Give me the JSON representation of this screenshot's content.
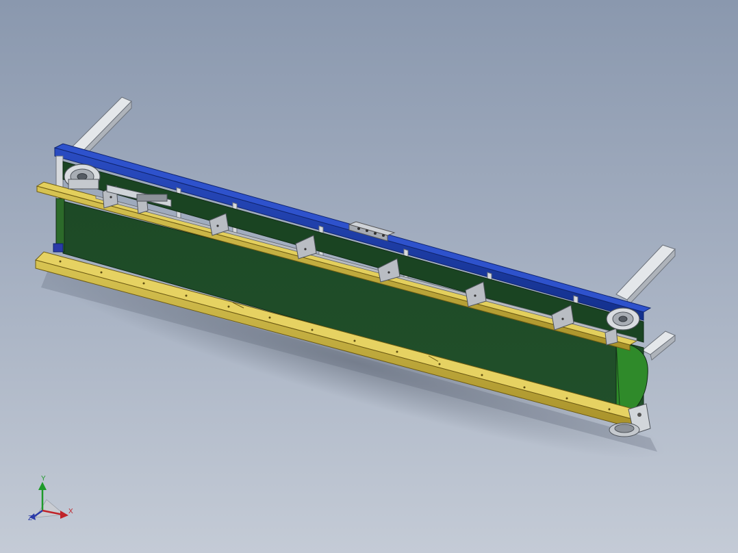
{
  "triad": {
    "x_label": "X",
    "y_label": "Y",
    "z_label": "Z",
    "x_color": "#c0242a",
    "y_color": "#1e9a2a",
    "z_color": "#2a3aa8"
  },
  "colors": {
    "belt": "#1f4d28",
    "belt_edge": "#2f8a2a",
    "top_rail": "#1a3aa8",
    "guide_rail": "#c9b23a",
    "frame": "#c8ccd2",
    "background_top": "#8a98ae",
    "background_bottom": "#c4cbd6"
  }
}
